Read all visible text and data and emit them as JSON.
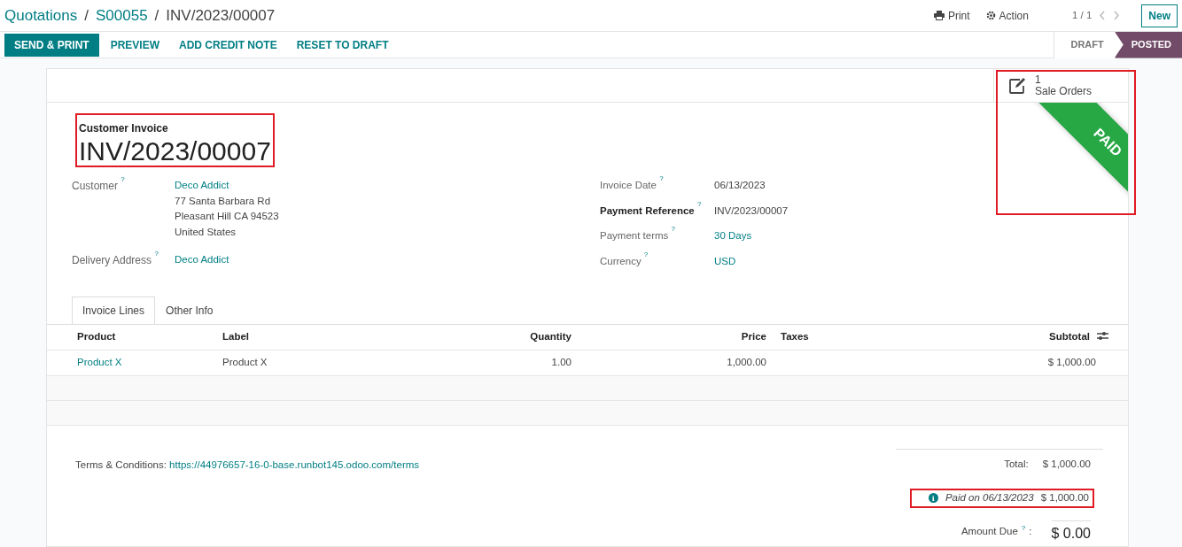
{
  "breadcrumbs": [
    {
      "label": "Quotations",
      "link": true
    },
    {
      "separator": "/",
      "label": "S00055",
      "link": true
    },
    {
      "separator": "/",
      "label": "INV/2023/00007",
      "link": false
    }
  ],
  "control_panel": {
    "print": "Print",
    "action": "Action",
    "pager": "1 / 1",
    "new_button": "New"
  },
  "action_buttons": [
    {
      "label": "SEND & PRINT",
      "primary": true
    },
    {
      "label": "PREVIEW",
      "primary": false
    },
    {
      "label": "ADD CREDIT NOTE",
      "primary": false
    },
    {
      "label": "RESET TO DRAFT",
      "primary": false
    }
  ],
  "status_bar": [
    {
      "label": "DRAFT",
      "selected": false
    },
    {
      "label": "POSTED",
      "selected": true
    }
  ],
  "smart_button": {
    "count": "1",
    "label": "Sale Orders",
    "highlighted": true
  },
  "ribbon": {
    "text": "PAID"
  },
  "title": {
    "type_label": "Customer Invoice",
    "number": "INV/2023/00007",
    "highlighted": true
  },
  "left_fields": [
    {
      "label": "Customer",
      "help": "?",
      "values": [
        {
          "text": "Deco Addict",
          "link": true
        },
        {
          "text": "77 Santa Barbara Rd",
          "link": false
        },
        {
          "text": "Pleasant Hill CA 94523",
          "link": false
        },
        {
          "text": "United States",
          "link": false
        }
      ]
    },
    {
      "label": "Delivery Address",
      "help": "?",
      "values": [
        {
          "text": "Deco Addict",
          "link": true
        }
      ]
    }
  ],
  "right_fields": [
    {
      "label": "Invoice Date",
      "help": "?",
      "bold": false,
      "value": "06/13/2023",
      "link": false
    },
    {
      "label": "Payment Reference",
      "help": "?",
      "bold": true,
      "value": "INV/2023/00007",
      "link": false
    },
    {
      "label": "Payment terms",
      "help": "?",
      "bold": false,
      "value": "30 Days",
      "link": true
    },
    {
      "label": "Currency",
      "help": "?",
      "bold": false,
      "value": "USD",
      "link": true
    }
  ],
  "tabs": [
    {
      "label": "Invoice Lines",
      "selected": true
    },
    {
      "label": "Other Info",
      "selected": false
    }
  ],
  "table": {
    "columns": [
      "Product",
      "Label",
      "Quantity",
      "Price",
      "Taxes",
      "Subtotal"
    ],
    "rows": [
      [
        "Product X",
        "Product X",
        "1.00",
        "1,000.00",
        "",
        "$ 1,000.00"
      ]
    ]
  },
  "terms": {
    "label": "Terms & Conditions:",
    "url": "https://44976657-16-0-base.runbot145.odoo.com/terms"
  },
  "totals": {
    "total_label": "Total:",
    "total": "$ 1,000.00",
    "payment_icon": "i",
    "payment_label": "Paid on 06/13/2023",
    "payment_amount": "$ 1,000.00",
    "payment_highlighted": true,
    "due_label": "Amount Due",
    "due_help": "?",
    "due_colon": ":",
    "due": "$ 0.00"
  }
}
